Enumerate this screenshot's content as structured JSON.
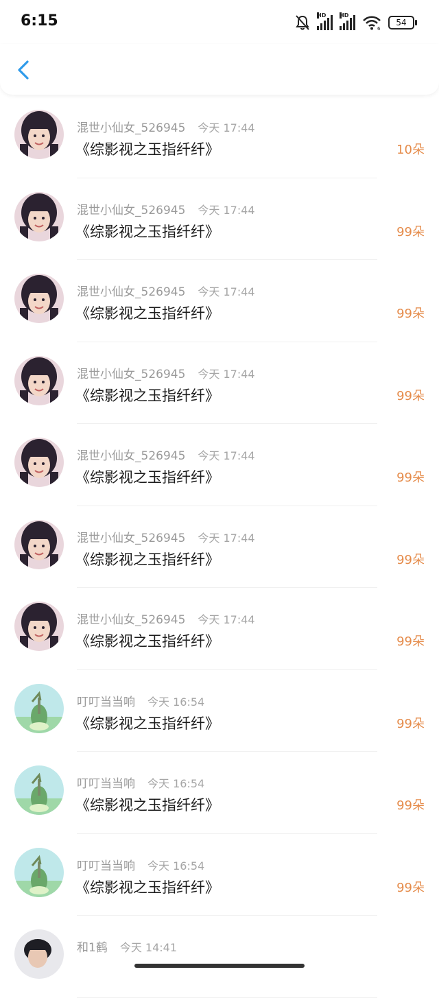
{
  "status_bar": {
    "time": "6:15",
    "hd1": "HD",
    "hd2": "HD",
    "wifi_sub": "6",
    "battery": "54"
  },
  "header": {
    "back_icon": "chevron-left-icon"
  },
  "rows": [
    {
      "name": "混世小仙女_526945",
      "time": "今天 17:44",
      "title": "《综影视之玉指纤纤》",
      "amount": "10朵",
      "avatar": "girl"
    },
    {
      "name": "混世小仙女_526945",
      "time": "今天 17:44",
      "title": "《综影视之玉指纤纤》",
      "amount": "99朵",
      "avatar": "girl"
    },
    {
      "name": "混世小仙女_526945",
      "time": "今天 17:44",
      "title": "《综影视之玉指纤纤》",
      "amount": "99朵",
      "avatar": "girl"
    },
    {
      "name": "混世小仙女_526945",
      "time": "今天 17:44",
      "title": "《综影视之玉指纤纤》",
      "amount": "99朵",
      "avatar": "girl"
    },
    {
      "name": "混世小仙女_526945",
      "time": "今天 17:44",
      "title": "《综影视之玉指纤纤》",
      "amount": "99朵",
      "avatar": "girl"
    },
    {
      "name": "混世小仙女_526945",
      "time": "今天 17:44",
      "title": "《综影视之玉指纤纤》",
      "amount": "99朵",
      "avatar": "girl"
    },
    {
      "name": "混世小仙女_526945",
      "time": "今天 17:44",
      "title": "《综影视之玉指纤纤》",
      "amount": "99朵",
      "avatar": "girl"
    },
    {
      "name": "叮叮当当响",
      "time": "今天 16:54",
      "title": "《综影视之玉指纤纤》",
      "amount": "99朵",
      "avatar": "tree"
    },
    {
      "name": "叮叮当当响",
      "time": "今天 16:54",
      "title": "《综影视之玉指纤纤》",
      "amount": "99朵",
      "avatar": "tree"
    },
    {
      "name": "叮叮当当响",
      "time": "今天 16:54",
      "title": "《综影视之玉指纤纤》",
      "amount": "99朵",
      "avatar": "tree"
    },
    {
      "name": "和1鹤",
      "time": "今天 14:41",
      "title": "",
      "amount": "",
      "avatar": "boy"
    }
  ],
  "colors": {
    "amount": "#e58b4a",
    "back": "#2f9bea",
    "meta": "#9a9a9a"
  }
}
